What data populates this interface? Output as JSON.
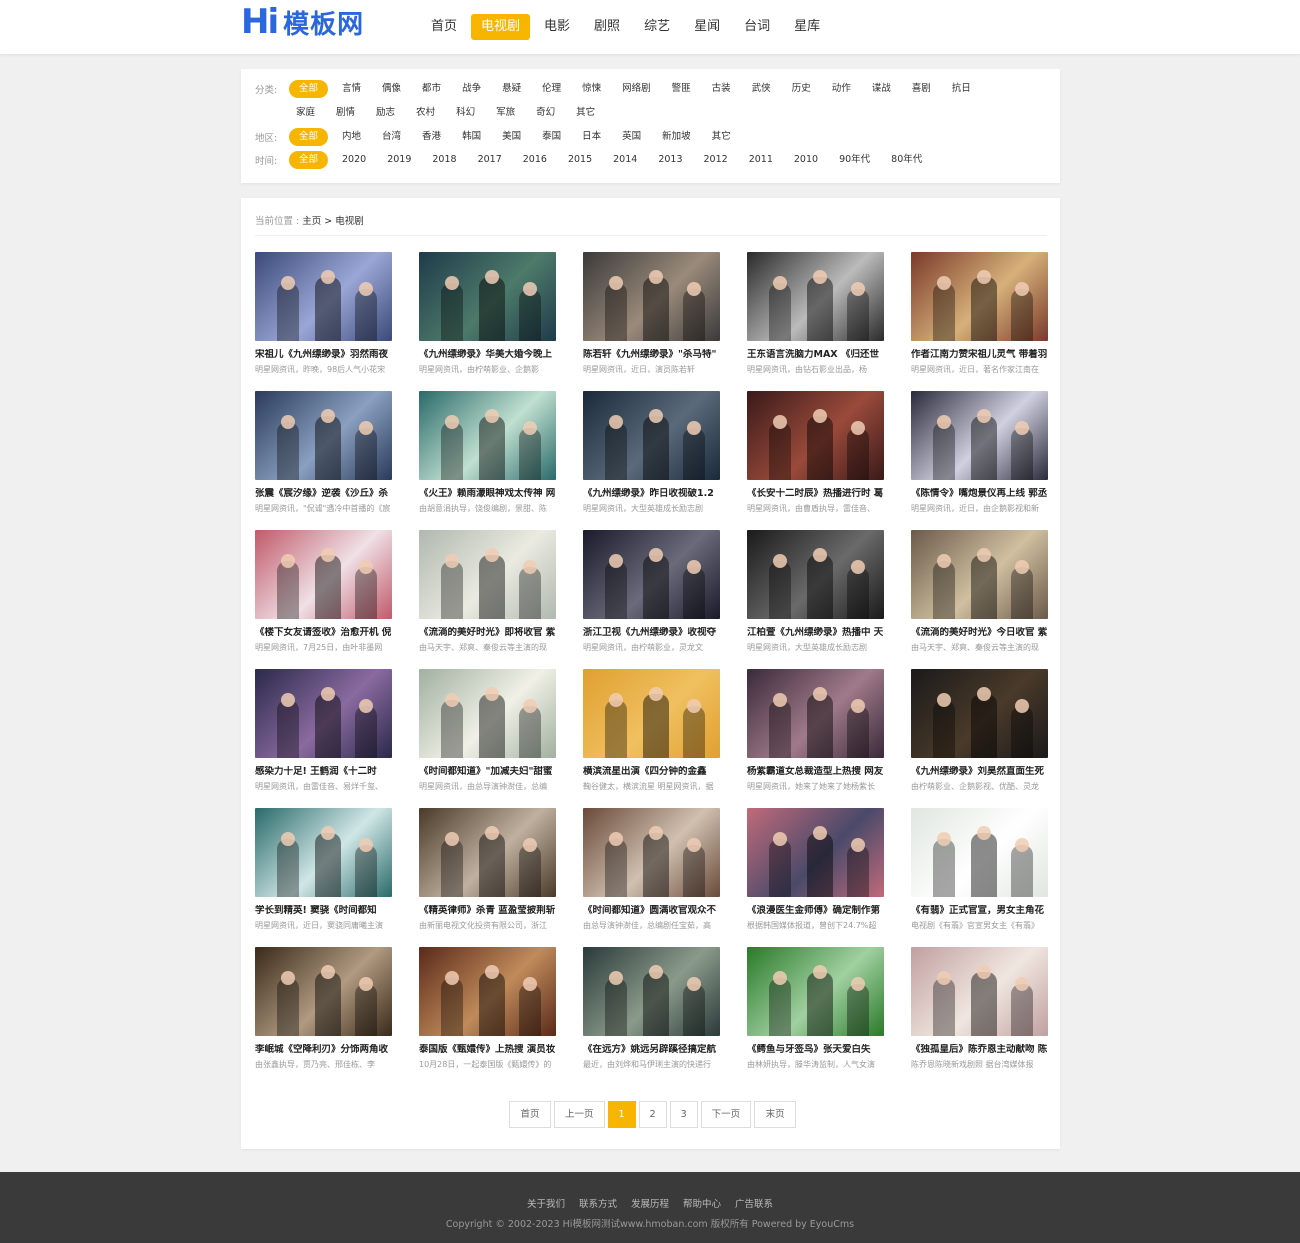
{
  "logo": {
    "hi": "Hi",
    "name": "模板网"
  },
  "nav": [
    "首页",
    "电视剧",
    "电影",
    "剧照",
    "综艺",
    "星闻",
    "台词",
    "星库"
  ],
  "nav_active": 1,
  "filters": {
    "category_label": "分类:",
    "category_row1": [
      "全部",
      "言情",
      "偶像",
      "都市",
      "战争",
      "悬疑",
      "伦理",
      "惊悚",
      "网络剧",
      "警匪",
      "古装",
      "武侠",
      "历史",
      "动作",
      "谍战",
      "喜剧",
      "抗日"
    ],
    "category_row2": [
      "家庭",
      "剧情",
      "励志",
      "农村",
      "科幻",
      "军旅",
      "奇幻",
      "其它"
    ],
    "region_label": "地区:",
    "region": [
      "全部",
      "内地",
      "台湾",
      "香港",
      "韩国",
      "美国",
      "泰国",
      "日本",
      "英国",
      "新加坡",
      "其它"
    ],
    "time_label": "时间:",
    "time": [
      "全部",
      "2020",
      "2019",
      "2018",
      "2017",
      "2016",
      "2015",
      "2014",
      "2013",
      "2012",
      "2011",
      "2010",
      "90年代",
      "80年代"
    ]
  },
  "breadcrumb": {
    "prefix": "当前位置 : ",
    "home": "主页",
    "sep": " > ",
    "current": "电视剧"
  },
  "cards": [
    {
      "title": "宋祖儿《九州缥缈录》羽然雨夜",
      "desc": "明星网资讯，昨晚，98后人气小花宋",
      "c1": "#3b4a7a",
      "c2": "#9aa6d6"
    },
    {
      "title": "《九州缥缈录》华美大婚今晚上",
      "desc": "明星网资讯，由柠萌影业、企鹅影",
      "c1": "#1f3b4a",
      "c2": "#4d7a6a"
    },
    {
      "title": "陈若轩《九州缥缈录》\"杀马特\"",
      "desc": "明星网资讯，近日，演员陈若轩",
      "c1": "#3a3a3a",
      "c2": "#9a8a7a"
    },
    {
      "title": "王东语言洗脑力MAX 《归还世",
      "desc": "明星网资讯，由钻石影业出品，杨",
      "c1": "#2a2a2a",
      "c2": "#bbbbbb"
    },
    {
      "title": "作者江南力赞宋祖儿灵气 带着羽",
      "desc": "明星网资讯，近日，著名作家江南在",
      "c1": "#7a3a2a",
      "c2": "#d6b07a"
    },
    {
      "title": "张震《宸汐缘》逆袭《沙丘》杀",
      "desc": "明星网资讯，\"侃谑\"遇冷中首播的《宸",
      "c1": "#2a3a5a",
      "c2": "#8aa0c0"
    },
    {
      "title": "《火王》赖雨濛眼神戏太传神 网",
      "desc": "由胡意涓执导，饶俊编剧，景甜、陈",
      "c1": "#2a6a6a",
      "c2": "#c0e0d0"
    },
    {
      "title": "《九州缥缈录》昨日收视破1.2",
      "desc": "明星网资讯，大型英雄成长励志剧",
      "c1": "#1a2a3a",
      "c2": "#5a6a7a"
    },
    {
      "title": "《长安十二时辰》热播进行时 葛",
      "desc": "明星网资讯，由曹盾执导，雷佳音、",
      "c1": "#3a1a1a",
      "c2": "#9a4a3a"
    },
    {
      "title": "《陈情令》嘴炮景仪再上线 郭丞",
      "desc": "明星网资讯，近日，由企鹅影视和新",
      "c1": "#2a2a3a",
      "c2": "#d0d0e0"
    },
    {
      "title": "《楼下女友请签收》治愈开机 倪",
      "desc": "明星网资讯，7月25日，由叶非墨网",
      "c1": "#c05a6a",
      "c2": "#f0e0e6"
    },
    {
      "title": "《流淌的美好时光》即将收官 紫",
      "desc": "由马天宇、郑爽、秦俊云等主演的现",
      "c1": "#b0b8b0",
      "c2": "#eaeae0"
    },
    {
      "title": "浙江卫视《九州缥缈录》收视夺",
      "desc": "明星网资讯，由柠萌影业，灵龙文",
      "c1": "#1a1a2a",
      "c2": "#6a6a7a"
    },
    {
      "title": "江柏萱《九州缥缈录》热播中 天",
      "desc": "明星网资讯，大型英雄成长励志剧",
      "c1": "#1a1a1a",
      "c2": "#6a6a6a"
    },
    {
      "title": "《流淌的美好时光》今日收官 紫",
      "desc": "由马天宇、郑爽、秦俊云等主演的现",
      "c1": "#6a5a4a",
      "c2": "#d0c0a0"
    },
    {
      "title": "感染力十足! 王鹤润《十二时",
      "desc": "明星网资讯，由雷佳音、易烊千玺、",
      "c1": "#2a2a4a",
      "c2": "#8a6aa0"
    },
    {
      "title": "《时间都知道》\"加减夫妇\"甜蜜",
      "desc": "明星网资讯，由总导演钟澍佳，总编",
      "c1": "#a0b0a0",
      "c2": "#f0f0e6"
    },
    {
      "title": "横滨流星出演《四分钟的金鑫",
      "desc": "鞠谷健太，横滨流星 明星网资讯，据",
      "c1": "#e0a030",
      "c2": "#f0c060"
    },
    {
      "title": "杨紫霸道女总裁造型上热搜 网友",
      "desc": "明星网资讯，她来了她来了她杨紫长",
      "c1": "#3a2a3a",
      "c2": "#a07a8a"
    },
    {
      "title": "《九州缥缈录》刘昊然直面生死",
      "desc": "由柠萌影业、企鹅影视、优酷、灵龙",
      "c1": "#1a1a1a",
      "c2": "#4a3a2a"
    },
    {
      "title": "学长到精英! 窦骁《时间都知",
      "desc": "明星网资讯，近日，窦骁同庸曦主演",
      "c1": "#2a6a6a",
      "c2": "#d0e6e6"
    },
    {
      "title": "《精英律师》杀青 蓝盈莹披荆斩",
      "desc": "由新丽电视文化投资有限公司，浙江",
      "c1": "#4a3a2a",
      "c2": "#c0b0a0"
    },
    {
      "title": "《时间都知道》圆满收官观众不",
      "desc": "由总导演钟澍佳，总编剧任宝茹，高",
      "c1": "#6a4a3a",
      "c2": "#d0c0b0"
    },
    {
      "title": "《浪漫医生金师傅》确定制作第",
      "desc": "根据韩国媒体报道，曾创下24.7%超",
      "c1": "#c06a7a",
      "c2": "#4a4a6a"
    },
    {
      "title": "《有翡》正式官宣，男女主角花",
      "desc": "电视剧《有翡》官宣男女主《有翡》",
      "c1": "#e0e6e0",
      "c2": "#ffffff"
    },
    {
      "title": "李岷城《空降利刃》分饰两角收",
      "desc": "由张鑫执导，贾乃亮、邢佳栋、李",
      "c1": "#3a2a1a",
      "c2": "#b09a80"
    },
    {
      "title": "泰国版《甄嬛传》上热搜 演员妆",
      "desc": "10月28日，一起泰国版《甄嬛传》的",
      "c1": "#5a2a1a",
      "c2": "#c08a5a"
    },
    {
      "title": "《在远方》姚远另辟蹊径搞定航",
      "desc": "最近，由刘烨和马伊琍主演的快递行",
      "c1": "#2a3a3a",
      "c2": "#8a9a8a"
    },
    {
      "title": "《鳄鱼与牙签鸟》张天爱白失",
      "desc": "由林妍执导，滕华涛监制，人气女演",
      "c1": "#2a7a2a",
      "c2": "#a0d0a0"
    },
    {
      "title": "《独孤皇后》陈乔恩主动献吻 陈",
      "desc": "陈乔恩陈晓新戏剧照 据台湾媒体报",
      "c1": "#c0a0a0",
      "c2": "#f0e6e0"
    }
  ],
  "pager": {
    "first": "首页",
    "prev": "上一页",
    "pages": [
      "1",
      "2",
      "3"
    ],
    "next": "下一页",
    "last": "末页",
    "current": 0
  },
  "footer": {
    "links": [
      "关于我们",
      "联系方式",
      "发展历程",
      "帮助中心",
      "广告联系"
    ],
    "copyright": "Copyright © 2002-2023 Hi模板网测试www.hmoban.com 版权所有   Powered by EyouCms"
  }
}
